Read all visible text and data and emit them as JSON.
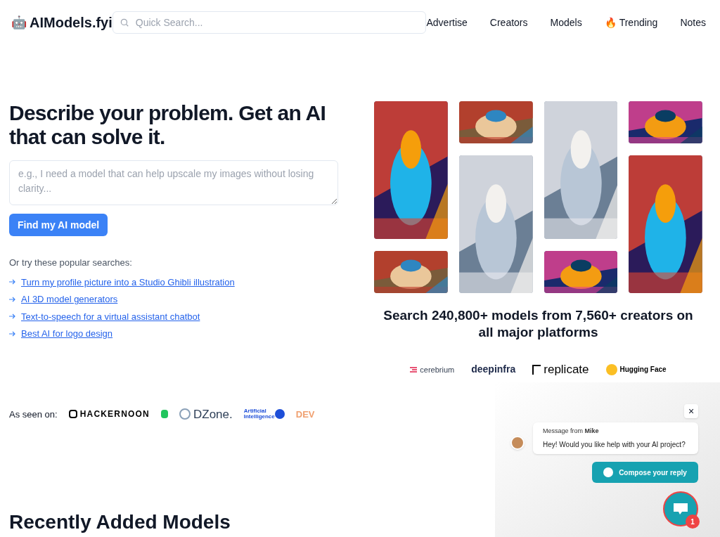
{
  "brand": {
    "icon": "🤖",
    "name": "AIModels.fyi"
  },
  "search": {
    "placeholder": "Quick Search..."
  },
  "nav": [
    {
      "label": "Advertise"
    },
    {
      "label": "Creators"
    },
    {
      "label": "Models"
    },
    {
      "label": "Trending",
      "icon": "🔥"
    },
    {
      "label": "Notes"
    }
  ],
  "hero": {
    "title": "Describe your problem. Get an AI that can solve it.",
    "input_placeholder": "e.g., I need a model that can help upscale my images without losing clarity...",
    "button": "Find my AI model",
    "popular_label": "Or try these popular searches:",
    "popular": [
      "Turn my profile picture into a Studio Ghibli illustration",
      "AI 3D model generators",
      "Text-to-speech for a virtual assistant chatbot",
      "Best AI for logo design"
    ]
  },
  "as_seen_on": {
    "label": "As seen on:",
    "logos": [
      {
        "kind": "hackernoon",
        "text": "HACKERNOON"
      },
      {
        "kind": "b"
      },
      {
        "kind": "dzone",
        "text": "DZone."
      },
      {
        "kind": "ai",
        "text": "Artificial Intelligence"
      },
      {
        "kind": "dev",
        "text": "DEV"
      }
    ]
  },
  "stats": "Search 240,800+ models from 7,560+ creators on all major platforms",
  "platforms": [
    {
      "kind": "cerebrium",
      "text": "cerebrium"
    },
    {
      "kind": "deepinfra",
      "text": "deepinfra"
    },
    {
      "kind": "replicate",
      "text": "replicate"
    },
    {
      "kind": "huggingface",
      "text": "Hugging Face"
    }
  ],
  "chat": {
    "close": "×",
    "message": "Message from **Mike**",
    "text": "Hey! Would you like help with your AI project?",
    "reply": "Compose your reply",
    "badge": "1"
  },
  "section_title": "Recently Added Models"
}
